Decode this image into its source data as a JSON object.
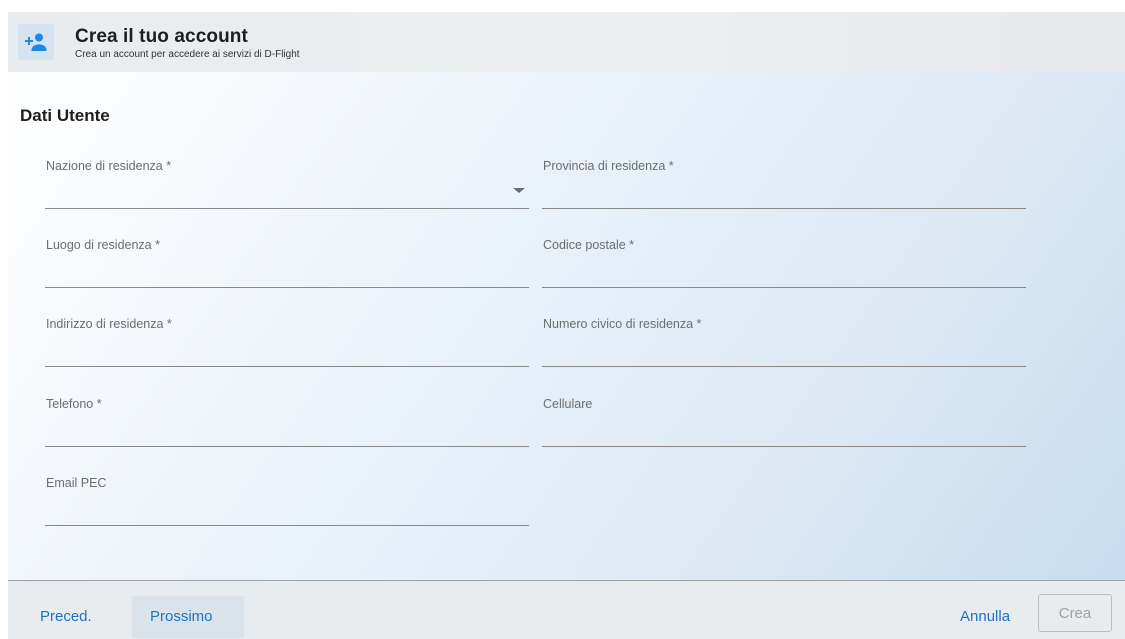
{
  "header": {
    "icon": "add-person-icon",
    "title": "Crea il tuo account",
    "subtitle": "Crea un account per accedere ai servizi di D-Flight"
  },
  "section": {
    "title": "Dati Utente"
  },
  "fields": {
    "nazione": {
      "label": "Nazione di residenza *",
      "value": ""
    },
    "provincia": {
      "label": "Provincia di residenza *",
      "value": ""
    },
    "luogo": {
      "label": "Luogo di residenza *",
      "value": ""
    },
    "codice_postale": {
      "label": "Codice postale *",
      "value": ""
    },
    "indirizzo": {
      "label": "Indirizzo di residenza *",
      "value": ""
    },
    "numero_civico": {
      "label": "Numero civico di residenza *",
      "value": ""
    },
    "telefono": {
      "label": "Telefono *",
      "value": ""
    },
    "cellulare": {
      "label": "Cellulare",
      "value": ""
    },
    "email_pec": {
      "label": "Email PEC",
      "value": ""
    }
  },
  "footer": {
    "prev_label": "Preced.",
    "next_label": "Prossimo",
    "cancel_label": "Annulla",
    "create_label": "Crea"
  },
  "colors": {
    "accent": "#1a73c9",
    "icon": "#1e88e5",
    "disabled": "#9ca1a6"
  }
}
